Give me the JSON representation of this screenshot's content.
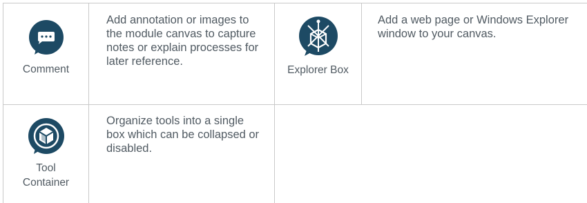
{
  "tools": [
    {
      "name": "Comment",
      "icon": "comment-bubble-icon",
      "description": "Add annotation or images to the module canvas to capture notes or explain processes for later reference."
    },
    {
      "name": "Explorer Box",
      "icon": "explorer-box-icon",
      "description": "Add a web page or Windows Explorer window to your canvas."
    },
    {
      "name": "Tool Container",
      "icon": "tool-container-icon",
      "description": "Organize tools into a single box which can be collapsed or disabled."
    }
  ],
  "colors": {
    "icon_fill": "#1d4a64",
    "text": "#505a62",
    "grid": "#c9c9c9"
  }
}
